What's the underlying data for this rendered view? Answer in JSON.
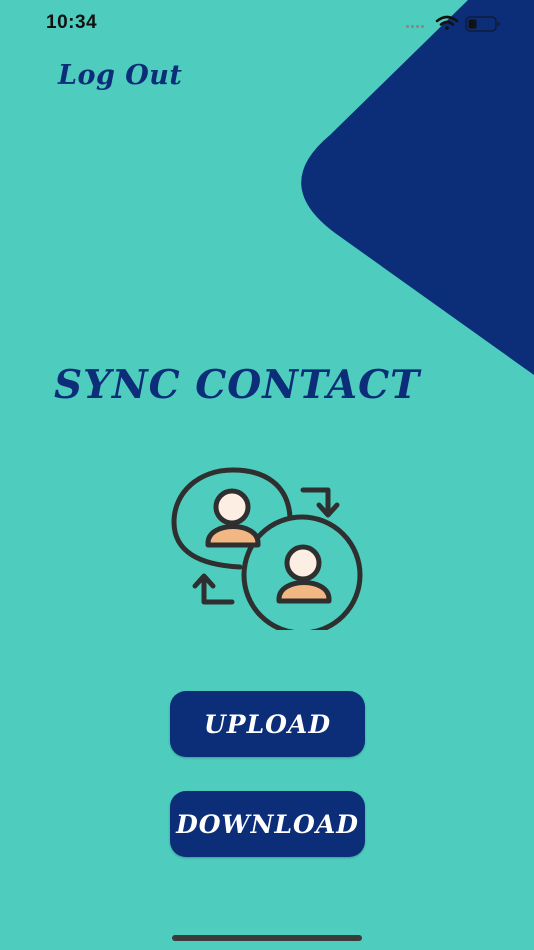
{
  "status_bar": {
    "time": "10:34",
    "icons": [
      "signal-icon",
      "wifi-icon",
      "battery-icon"
    ]
  },
  "header": {
    "logout_label": "Log Out"
  },
  "main": {
    "title": "SYNC CONTACT",
    "illustration_icon": "sync-contacts-icon",
    "upload_label": "UPLOAD",
    "download_label": "DOWNLOAD"
  },
  "colors": {
    "background": "#4ecdbf",
    "accent": "#0c2d78",
    "skin": "#f2b883"
  }
}
